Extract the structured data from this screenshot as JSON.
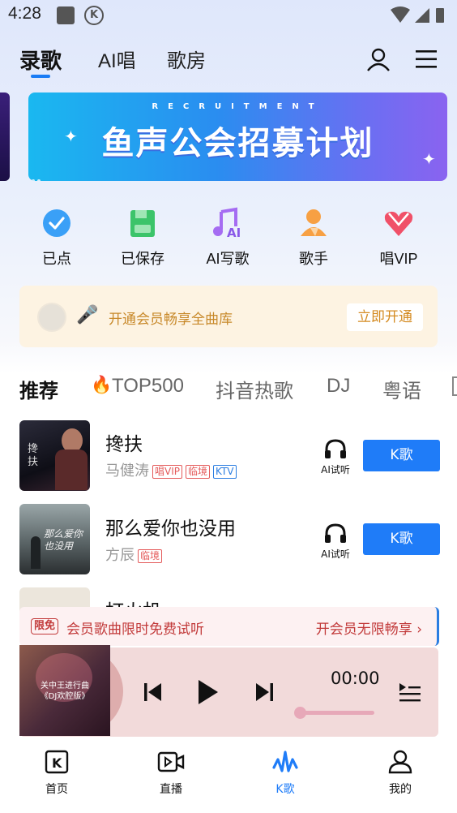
{
  "status": {
    "time": "4:28"
  },
  "top_tabs": [
    {
      "label": "录歌",
      "active": true
    },
    {
      "label": "AI唱",
      "active": false
    },
    {
      "label": "歌房",
      "active": false
    }
  ],
  "banner": {
    "small_text": "RECRUITMENT",
    "title": "鱼声公会招募计划"
  },
  "quick_actions": [
    {
      "label": "已点",
      "icon": "check-circle-icon"
    },
    {
      "label": "已保存",
      "icon": "save-icon"
    },
    {
      "label": "AI写歌",
      "icon": "ai-music-icon"
    },
    {
      "label": "歌手",
      "icon": "singer-icon"
    },
    {
      "label": "唱VIP",
      "icon": "vip-heart-icon"
    }
  ],
  "vip": {
    "text": "开通会员畅享全曲库",
    "button": "立即开通"
  },
  "categories": [
    {
      "label": "推荐",
      "active": true
    },
    {
      "label": "TOP500",
      "prefix_icon": "fire-icon",
      "active": false
    },
    {
      "label": "抖音热歌",
      "active": false
    },
    {
      "label": "DJ",
      "active": false
    },
    {
      "label": "粤语",
      "active": false
    }
  ],
  "songs": [
    {
      "title": "搀扶",
      "artist": "马健涛",
      "tags": [
        "唱VIP",
        "临境",
        "KTV"
      ],
      "cover_text": "搀扶",
      "ai_label": "AI试听",
      "k_label": "K歌"
    },
    {
      "title": "那么爱你也没用",
      "artist": "方辰",
      "tags": [
        "临境"
      ],
      "cover_text": "那么爱你也没用",
      "ai_label": "AI试听",
      "k_label": "K歌"
    },
    {
      "title": "打火机",
      "artist": "",
      "tags": [],
      "cover_text": "",
      "ai_label": "",
      "k_label": ""
    }
  ],
  "promo": {
    "badge": "限免",
    "text": "会员歌曲限时免费试听",
    "right": "开会员无限畅享"
  },
  "player": {
    "cover_line1": "关中王进行曲",
    "cover_line2": "《DJ欢腔版》",
    "time": "00:00",
    "progress": 0
  },
  "bottom_nav": [
    {
      "label": "首页",
      "icon": "home-k-icon",
      "active": false
    },
    {
      "label": "直播",
      "icon": "live-icon",
      "active": false
    },
    {
      "label": "K歌",
      "icon": "k-wave-icon",
      "active": true
    },
    {
      "label": "我的",
      "icon": "profile-icon",
      "active": false
    }
  ],
  "colors": {
    "accent": "#1f7cf8",
    "vip_gold": "#c8892a",
    "promo_red": "#c23a3a"
  }
}
